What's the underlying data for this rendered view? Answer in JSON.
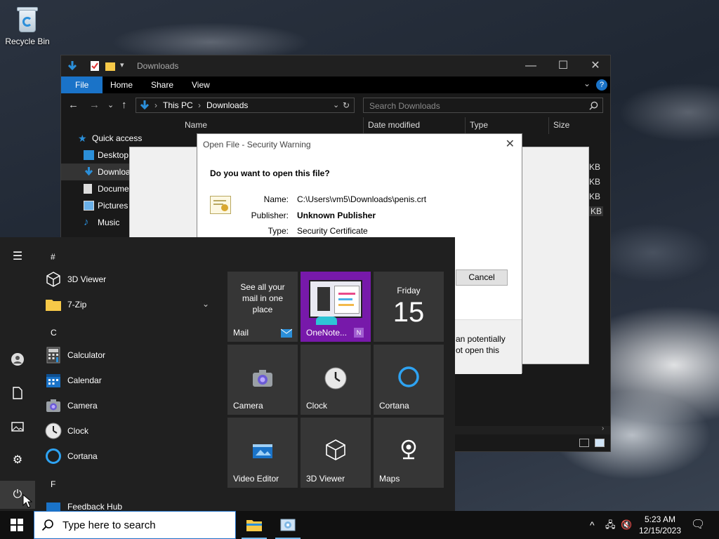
{
  "desktop": {
    "recycle_bin_label": "Recycle Bin"
  },
  "explorer": {
    "title": "Downloads",
    "ribbon_tabs": {
      "file": "File",
      "home": "Home",
      "share": "Share",
      "view": "View"
    },
    "help_glyph": "?",
    "address": {
      "root": "This PC",
      "current": "Downloads",
      "sep": "›"
    },
    "search_placeholder": "Search Downloads",
    "nav": {
      "quick_access": "Quick access",
      "desktop": "Desktop",
      "downloads": "Downloa",
      "documents": "Docume",
      "pictures": "Pictures",
      "music": "Music"
    },
    "columns": {
      "name": "Name",
      "date_modified": "Date modified",
      "type": "Type",
      "size": "Size"
    },
    "size_units": [
      "KB",
      "KB",
      "KB",
      "KB"
    ]
  },
  "security_dialog": {
    "title": "Open File - Security Warning",
    "question": "Do you want to open this file?",
    "labels": {
      "name": "Name:",
      "publisher": "Publisher:",
      "type": "Type:"
    },
    "values": {
      "name": "C:\\Users\\vm5\\Downloads\\penis.crt",
      "publisher": "Unknown Publisher",
      "type": "Security Certificate"
    },
    "cancel_label": "Cancel",
    "warning_line1": "an potentially",
    "warning_line2": "ot open this"
  },
  "start_menu": {
    "section_hash": "#",
    "section_c": "C",
    "section_f": "F",
    "apps": {
      "viewer3d": "3D Viewer",
      "zip": "7-Zip",
      "calculator": "Calculator",
      "calendar": "Calendar",
      "camera": "Camera",
      "clock": "Clock",
      "cortana": "Cortana",
      "feedback": "Feedback Hub"
    },
    "tiles": {
      "mail_promo": "See all your mail in one place",
      "mail": "Mail",
      "onenote": "OneNote...",
      "calendar_day": "Friday",
      "calendar_date": "15",
      "camera": "Camera",
      "clock": "Clock",
      "cortana": "Cortana",
      "video_editor": "Video Editor",
      "viewer3d": "3D Viewer",
      "maps": "Maps"
    }
  },
  "taskbar": {
    "search_placeholder": "Type here to search",
    "time": "5:23 AM",
    "date": "12/15/2023"
  },
  "colors": {
    "accent": "#1a73c8",
    "onenote_purple": "#7719aa",
    "cortana_blue": "#2ea3f2"
  }
}
